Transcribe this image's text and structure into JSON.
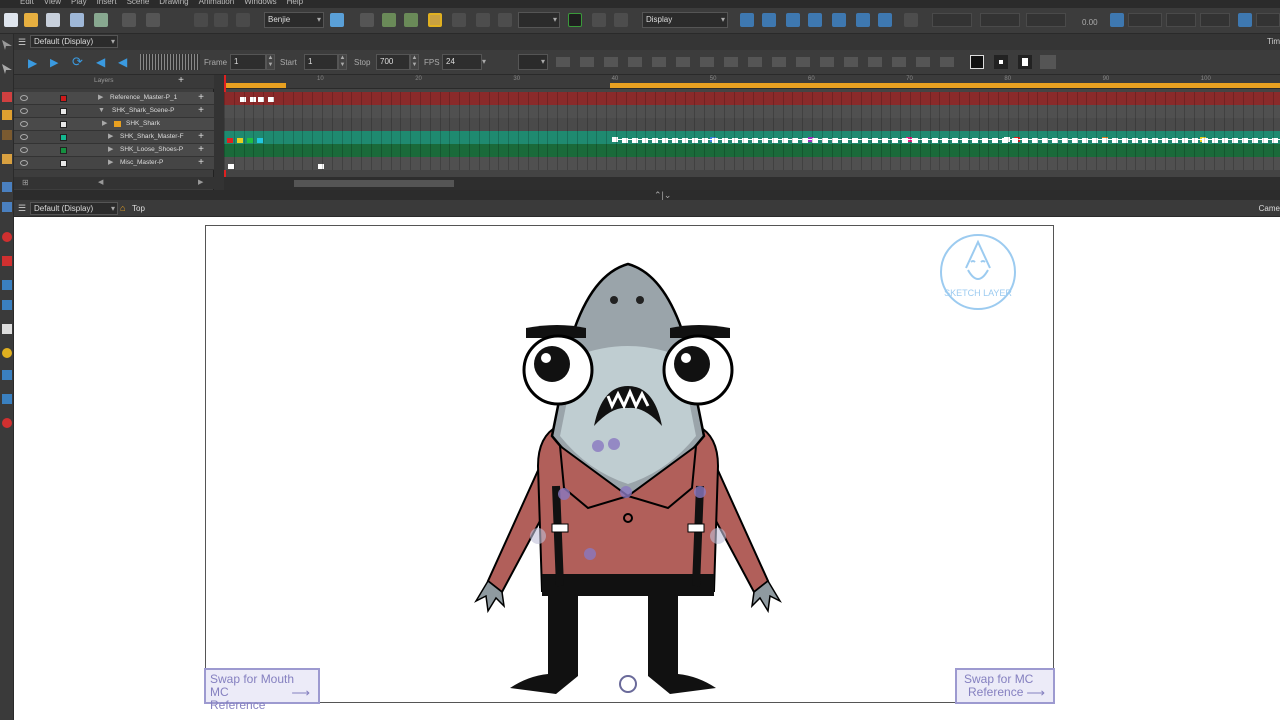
{
  "menu": [
    "Edit",
    "View",
    "Play",
    "Insert",
    "Scene",
    "Drawing",
    "Animation",
    "Windows",
    "Help"
  ],
  "toolbar": {
    "character_select": "Benjie",
    "display_select": "Display",
    "rotation_value": "0.00",
    "right_label": "Tim"
  },
  "timeline": {
    "view_select": "Default (Display)",
    "frame_label": "Frame",
    "frame_value": "1",
    "start_label": "Start",
    "start_value": "1",
    "stop_label": "Stop",
    "stop_value": "700",
    "fps_label": "FPS",
    "fps_value": "24",
    "layers_header": "Layers",
    "ruler_ticks": [
      "10",
      "20",
      "30",
      "40",
      "50",
      "60",
      "70",
      "80",
      "90",
      "100"
    ],
    "layers": [
      {
        "name": "Reference_Master-P_1",
        "color": "#cc1a1a"
      },
      {
        "name": "SHK_Shark_Scene-P",
        "color": "#e8e8e8"
      },
      {
        "name": "SHK_Shark",
        "color": "#e8a020"
      },
      {
        "name": "SHK_Shark_Master-F",
        "color": "#14b890"
      },
      {
        "name": "SHK_Loose_Shoes-P",
        "color": "#169040"
      },
      {
        "name": "Misc_Master-P",
        "color": "#e8e8e8"
      }
    ]
  },
  "camera": {
    "view_select": "Default (Display)",
    "breadcrumb": "Top",
    "right_label": "Came"
  },
  "canvas": {
    "sketch_badge": "SKETCH LAYER",
    "swap_mouth": {
      "line1": "Swap for Mouth MC",
      "line2": "Reference"
    },
    "swap_mc": {
      "line1": "Swap for MC",
      "line2": "Reference"
    }
  }
}
